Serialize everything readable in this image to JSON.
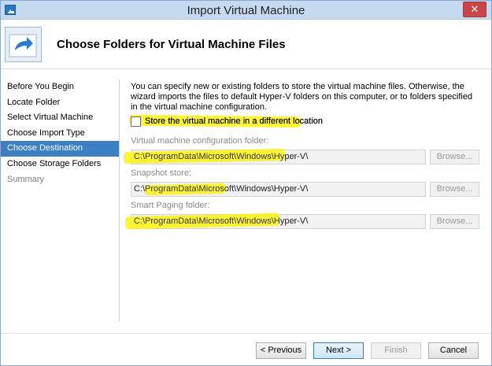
{
  "window": {
    "title": "Import Virtual Machine"
  },
  "header": {
    "title": "Choose Folders for Virtual Machine Files",
    "icon": "arrow-folder-icon"
  },
  "nav": {
    "items": [
      {
        "label": "Before You Begin",
        "state": "normal"
      },
      {
        "label": "Locate Folder",
        "state": "normal"
      },
      {
        "label": "Select Virtual Machine",
        "state": "normal"
      },
      {
        "label": "Choose Import Type",
        "state": "normal"
      },
      {
        "label": "Choose Destination",
        "state": "active"
      },
      {
        "label": "Choose Storage Folders",
        "state": "normal"
      },
      {
        "label": "Summary",
        "state": "disabled"
      }
    ]
  },
  "main": {
    "intro": "You can specify new or existing folders to store the virtual machine files. Otherwise, the wizard imports the files to default Hyper-V folders on this computer, or to folders specified in the virtual machine configuration.",
    "checkbox": {
      "label": "Store the virtual machine in a different location",
      "checked": false
    },
    "fields": [
      {
        "label": "Virtual machine configuration folder:",
        "value": "C:\\ProgramData\\Microsoft\\Windows\\Hyper-V\\",
        "browse": "Browse..."
      },
      {
        "label": "Snapshot store:",
        "value": "C:\\ProgramData\\Microsoft\\Windows\\Hyper-V\\",
        "browse": "Browse..."
      },
      {
        "label": "Smart Paging folder:",
        "value": "C:\\ProgramData\\Microsoft\\Windows\\Hyper-V\\",
        "browse": "Browse..."
      }
    ]
  },
  "footer": {
    "previous": "< Previous",
    "next": "Next >",
    "finish": "Finish",
    "cancel": "Cancel"
  },
  "colors": {
    "accent": "#3c7fc4",
    "titlebar": "#c5d9f1",
    "close": "#c7464a",
    "highlight": "#fff400"
  }
}
